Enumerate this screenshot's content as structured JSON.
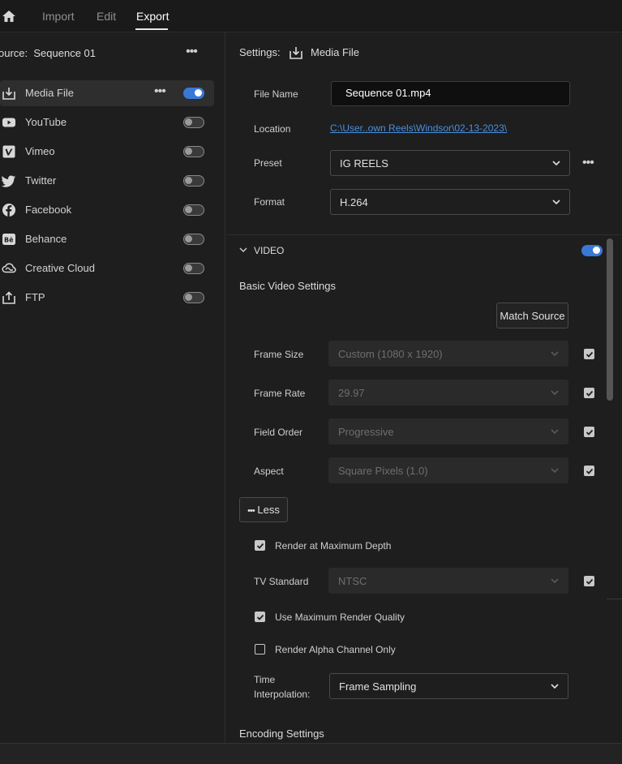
{
  "nav": {
    "tabs": [
      {
        "label": "Import"
      },
      {
        "label": "Edit"
      },
      {
        "label": "Export"
      }
    ]
  },
  "source": {
    "label": "ource:",
    "value": "Sequence 01"
  },
  "destinations": [
    {
      "label": "Media File",
      "icon": "download-icon",
      "enabled": true
    },
    {
      "label": "YouTube",
      "icon": "youtube-icon",
      "enabled": false
    },
    {
      "label": "Vimeo",
      "icon": "vimeo-icon",
      "enabled": false
    },
    {
      "label": "Twitter",
      "icon": "twitter-icon",
      "enabled": false
    },
    {
      "label": "Facebook",
      "icon": "facebook-icon",
      "enabled": false
    },
    {
      "label": "Behance",
      "icon": "behance-icon",
      "enabled": false
    },
    {
      "label": "Creative Cloud",
      "icon": "creative-cloud-icon",
      "enabled": false
    },
    {
      "label": "FTP",
      "icon": "upload-icon",
      "enabled": false
    }
  ],
  "settings": {
    "header_label": "Settings:",
    "target": "Media File",
    "file_name_label": "File Name",
    "file_name_value": "Sequence 01.mp4",
    "location_label": "Location",
    "location_value": "C:\\User..own Reels\\Windsor\\02-13-2023\\",
    "preset_label": "Preset",
    "preset_value": "IG REELS",
    "format_label": "Format",
    "format_value": "H.264"
  },
  "video": {
    "section_label": "VIDEO",
    "enabled": true,
    "basic_title": "Basic Video Settings",
    "match_source": "Match Source",
    "frame_size_label": "Frame Size",
    "frame_size_value": "Custom (1080 x 1920)",
    "frame_rate_label": "Frame Rate",
    "frame_rate_value": "29.97",
    "field_order_label": "Field Order",
    "field_order_value": "Progressive",
    "aspect_label": "Aspect",
    "aspect_value": "Square Pixels (1.0)",
    "less_button": "Less",
    "render_max_depth": "Render at Maximum Depth",
    "tv_standard_label": "TV Standard",
    "tv_standard_value": "NTSC",
    "use_max_quality": "Use Maximum Render Quality",
    "render_alpha": "Render Alpha Channel Only",
    "time_interp_label_1": "Time",
    "time_interp_label_2": "Interpolation:",
    "time_interp_value": "Frame Sampling",
    "encoding_title": "Encoding Settings"
  },
  "colors": {
    "accent": "#3a78d6",
    "link": "#4a8fe0",
    "background": "#1e1e1e"
  }
}
